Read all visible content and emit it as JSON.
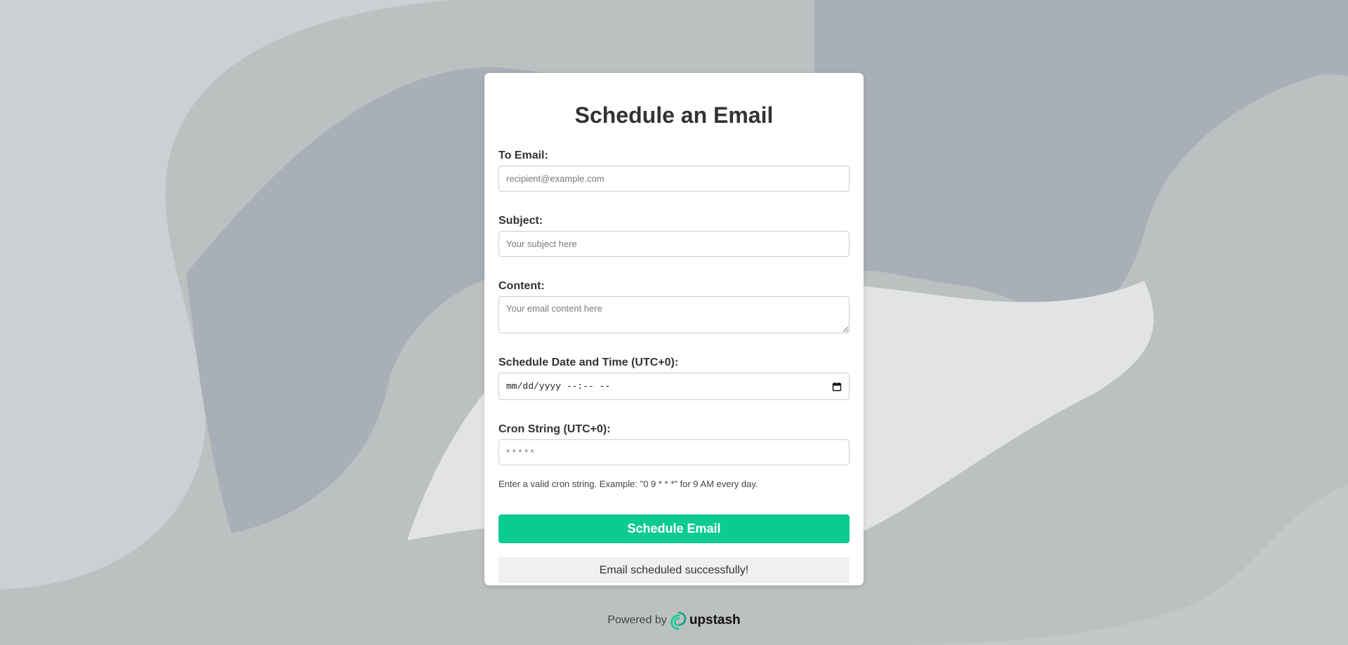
{
  "form": {
    "title": "Schedule an Email",
    "to_email": {
      "label": "To Email:",
      "placeholder": "recipient@example.com",
      "value": ""
    },
    "subject": {
      "label": "Subject:",
      "placeholder": "Your subject here",
      "value": ""
    },
    "content": {
      "label": "Content:",
      "placeholder": "Your email content here",
      "value": ""
    },
    "schedule": {
      "label": "Schedule Date and Time (UTC+0):",
      "value_display": "mm/dd/yyyy --:-- --"
    },
    "cron": {
      "label": "Cron String (UTC+0):",
      "placeholder": "* * * * *",
      "help": "Enter a valid cron string. Example: \"0 9 * * *\" for 9 AM every day."
    },
    "submit_label": "Schedule Email",
    "status_message": "Email scheduled successfully!"
  },
  "footer": {
    "powered_by": "Powered by",
    "brand": "upstash"
  },
  "icons": {
    "calendar": "calendar-icon",
    "logo": "upstash-logo-icon"
  },
  "colors": {
    "accent": "#0ccb91",
    "background_light": "#cbd1d3",
    "background_mid": "#bcc0c1",
    "background_dark": "#a9afb7",
    "background_pale": "#e2e3e5",
    "card": "#ffffff",
    "status_bg": "#f0f0f0"
  }
}
